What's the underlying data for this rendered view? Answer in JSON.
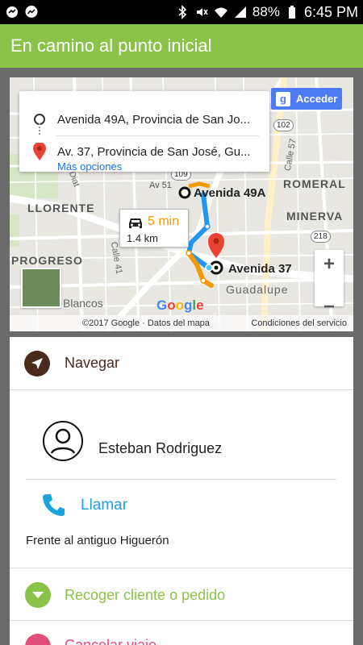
{
  "statusbar": {
    "left_icons": [
      "notification-icon",
      "messenger-icon"
    ],
    "right_icons": [
      "bluetooth-icon",
      "mute-icon",
      "wifi-icon",
      "signal-icon"
    ],
    "battery": "88%",
    "time": "6:45 PM"
  },
  "appbar": {
    "title": "En camino al punto inicial"
  },
  "map": {
    "origin_text": "Avenida 49A, Provincia de San Jo...",
    "dest_text": "Av. 37, Provincia de San José, Gu...",
    "more_options": "Más opciones",
    "signin_label": "Acceder",
    "eta_time": "5 min",
    "eta_distance": "1.4 km",
    "labels": {
      "origin_marker": "Avenida 49A",
      "dest_marker": "Avenida 37",
      "lloreente": "LLORENTE",
      "progreso": "PROGRESO",
      "romeral": "ROMERAL",
      "minerva": "MINERVA",
      "guadalupe": "Guadalupe",
      "blancos": "Blancos",
      "calle57": "Calle 57",
      "calle41": "Calle 41",
      "diat": "Diat"
    },
    "shields": {
      "s102": "102",
      "s109": "109",
      "s218": "218",
      "av51": "Av 51"
    },
    "copyright": "©2017 Google · Datos del mapa",
    "terms": "Condiciones del servicio",
    "google": "Google"
  },
  "card": {
    "navigate": "Navegar",
    "contact_name": "Esteban Rodriguez",
    "call": "Llamar",
    "reference": "Frente al antiguo Higuerón",
    "pickup": "Recoger cliente o pedido",
    "cancel": "Cancelar viaje"
  },
  "colors": {
    "accent": "#8bc34a",
    "navigate_icon": "#4a2a1c",
    "call": "#1ba3de",
    "cancel": "#e04e7a",
    "route_blue": "#2196f3",
    "route_orange": "#f29900"
  }
}
